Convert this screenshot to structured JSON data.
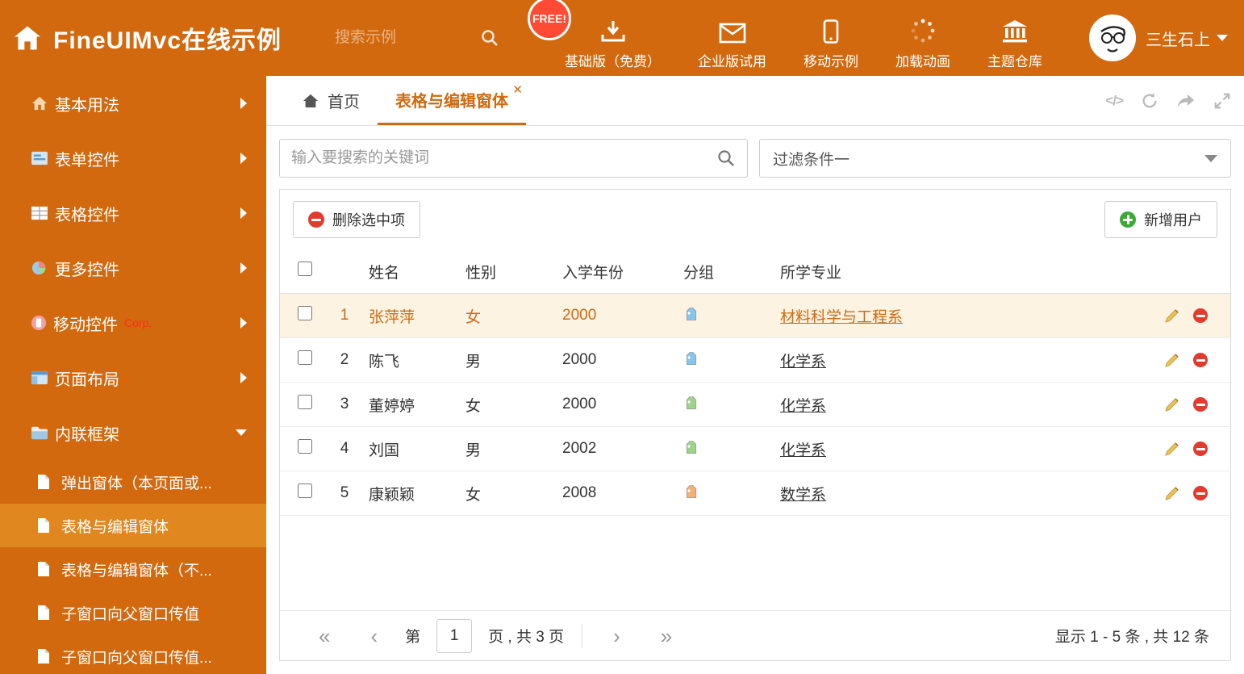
{
  "header": {
    "title": "FineUIMvc在线示例",
    "search_placeholder": "搜索示例",
    "free_badge": "FREE!",
    "nav": [
      {
        "label": "基础版（免费）"
      },
      {
        "label": "企业版试用"
      },
      {
        "label": "移动示例"
      },
      {
        "label": "加载动画"
      },
      {
        "label": "主题仓库"
      }
    ],
    "user": {
      "name": "三生石上"
    }
  },
  "sidebar": {
    "items": [
      {
        "label": "基本用法"
      },
      {
        "label": "表单控件"
      },
      {
        "label": "表格控件"
      },
      {
        "label": "更多控件"
      },
      {
        "label": "移动控件",
        "badge": "Corp."
      },
      {
        "label": "页面布局"
      },
      {
        "label": "内联框架"
      }
    ],
    "subitems": [
      {
        "label": "弹出窗体（本页面或..."
      },
      {
        "label": "表格与编辑窗体"
      },
      {
        "label": "表格与编辑窗体（不..."
      },
      {
        "label": "子窗口向父窗口传值"
      },
      {
        "label": "子窗口向父窗口传值..."
      }
    ]
  },
  "tabs": [
    {
      "label": "首页"
    },
    {
      "label": "表格与编辑窗体"
    }
  ],
  "filters": {
    "search_placeholder": "输入要搜索的关键词",
    "filter_value": "过滤条件一"
  },
  "toolbar": {
    "delete_label": "删除选中项",
    "add_label": "新增用户"
  },
  "table": {
    "columns": [
      "姓名",
      "性别",
      "入学年份",
      "分组",
      "所学专业"
    ],
    "rows": [
      {
        "index": "1",
        "name": "张萍萍",
        "gender": "女",
        "year": "2000",
        "tag_color": "#86c5ec",
        "major": "材料科学与工程系"
      },
      {
        "index": "2",
        "name": "陈飞",
        "gender": "男",
        "year": "2000",
        "tag_color": "#86c5ec",
        "major": "化学系"
      },
      {
        "index": "3",
        "name": "董婷婷",
        "gender": "女",
        "year": "2000",
        "tag_color": "#9ed489",
        "major": "化学系"
      },
      {
        "index": "4",
        "name": "刘国",
        "gender": "男",
        "year": "2002",
        "tag_color": "#9ed489",
        "major": "化学系"
      },
      {
        "index": "5",
        "name": "康颖颖",
        "gender": "女",
        "year": "2008",
        "tag_color": "#f3b176",
        "major": "数学系"
      }
    ]
  },
  "pagination": {
    "page_prefix": "第",
    "page_value": "1",
    "page_suffix": "页 , 共 3 页",
    "summary": "显示 1 - 5 条 , 共 12 条"
  }
}
